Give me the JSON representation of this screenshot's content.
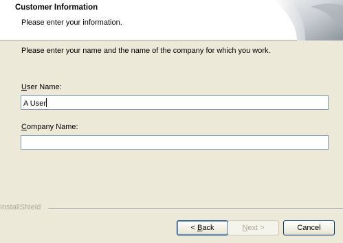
{
  "header": {
    "title": "Customer Information",
    "subtitle": "Please enter your information."
  },
  "instruction": "Please enter your name and the name of the company for which you work.",
  "fields": {
    "user_name": {
      "label_accel": "U",
      "label_rest": "ser Name:",
      "value": "A User"
    },
    "company_name": {
      "label_accel": "C",
      "label_rest": "ompany Name:",
      "value": ""
    }
  },
  "brand": "InstallShield",
  "buttons": {
    "back": {
      "prefix": "< ",
      "accel": "B",
      "rest": "ack"
    },
    "next": {
      "accel": "N",
      "rest": "ext >"
    },
    "cancel": "Cancel"
  },
  "colors": {
    "dialog_bg": "#ece9d8",
    "textbox_border": "#7f9db9",
    "button_border": "#003c74",
    "disabled_text": "#aca899"
  },
  "icons": {
    "header_art": "page-curl-graphic"
  }
}
